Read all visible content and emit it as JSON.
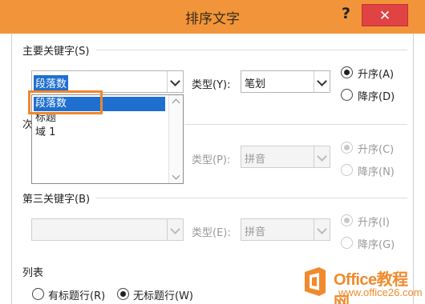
{
  "window": {
    "title": "排序文字",
    "help_label": "?",
    "close_label": "✕"
  },
  "primary_key": {
    "section_label": "主要关键字(S)",
    "field_value": "段落数",
    "type_label": "类型(Y):",
    "type_value": "笔划",
    "asc_label": "升序(A)",
    "desc_label": "降序(D)",
    "order": "asc"
  },
  "dropdown": {
    "options": [
      "段落数",
      "标题",
      "域 1"
    ],
    "selected_index": 0
  },
  "secondary_key": {
    "section_label_partial": "次",
    "type_label": "类型(P):",
    "type_value": "拼音",
    "asc_label": "升序(C)",
    "desc_label": "降序(N)"
  },
  "third_key": {
    "section_label": "第三关键字(B)",
    "field_value": "",
    "type_label": "类型(E):",
    "type_value": "拼音",
    "asc_label": "升序(I)",
    "desc_label": "降序(G)"
  },
  "list": {
    "section_label": "列表",
    "has_header_label": "有标题行(R)",
    "no_header_label": "无标题行(W)",
    "selected": "no_header"
  },
  "watermark": {
    "line1": "Office教程网",
    "line2": "www.office26.com"
  },
  "colors": {
    "titlebar": "#f2953a",
    "close": "#e04343",
    "selection": "#1f6fd1",
    "highlight_box": "#f0862e"
  }
}
